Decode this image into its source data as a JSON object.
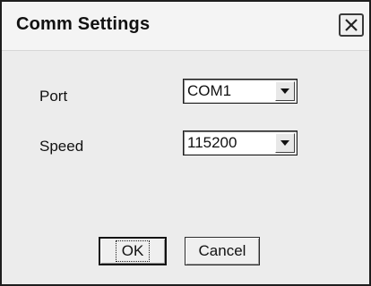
{
  "window": {
    "title": "Comm Settings",
    "close_icon": "close-icon"
  },
  "form": {
    "port_label": "Port",
    "port_value": "COM1",
    "speed_label": "Speed",
    "speed_value": "115200",
    "dropdown_icon": "chevron-down-icon"
  },
  "buttons": {
    "ok_label": "OK",
    "cancel_label": "Cancel"
  }
}
